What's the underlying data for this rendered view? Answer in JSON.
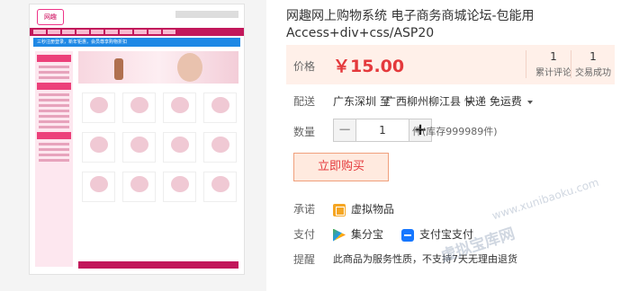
{
  "product": {
    "title": "网趣网上购物系统 电子商务商城论坛-包能用Access+div+css/ASP20",
    "price_label": "价格",
    "price": "￥15.00",
    "stats": [
      {
        "count": "1",
        "label": "累计评论"
      },
      {
        "count": "1",
        "label": "交易成功"
      }
    ]
  },
  "shipping": {
    "label": "配送",
    "from": "广东深圳",
    "to_word": "至",
    "to": "广西柳州柳江县",
    "method": "快递 免运费"
  },
  "quantity": {
    "label": "数量",
    "value": "1",
    "minus": "−",
    "plus": "+",
    "stock_text": "件(库存999989件)"
  },
  "buy_button": "立即购买",
  "promise": {
    "label": "承诺",
    "value": "虚拟物品"
  },
  "payment": {
    "label": "支付",
    "options": [
      "集分宝",
      "支付宝支付"
    ]
  },
  "notice": {
    "label": "提醒",
    "value": "此商品为服务性质，不支持7天无理由退货"
  },
  "thumbnail": {
    "brand_logo": "网趣",
    "banner_text": "三秒注册登录，新年钜惠，会员尊享购物折扣"
  },
  "watermark": {
    "url": "www.xunibaoku.com",
    "site": "虚拟宝库网"
  },
  "colors": {
    "price": "#e4393c",
    "price_bg": "#fff0e9",
    "buy_bg": "#ffeadf",
    "theme_pink": "#c2185b"
  }
}
